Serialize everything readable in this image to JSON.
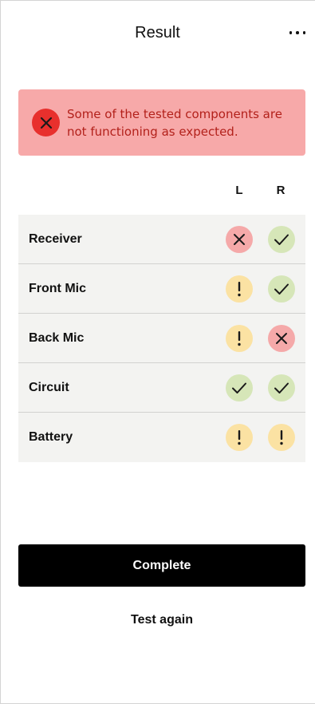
{
  "header": {
    "title": "Result",
    "more_icon": "more-horizontal-icon"
  },
  "alert": {
    "icon": "error-x-icon",
    "message": "Some of the tested components are not functioning as expected.",
    "colors": {
      "background": "#f7a9a9",
      "text": "#b3211b",
      "icon_bg": "#e8302d"
    }
  },
  "columns": {
    "left": "L",
    "right": "R"
  },
  "status_colors": {
    "fail": "#f5a9a9",
    "pass": "#d6e6b8",
    "warn": "#fbe2a3"
  },
  "components": [
    {
      "label": "Receiver",
      "left": "fail",
      "right": "pass"
    },
    {
      "label": "Front Mic",
      "left": "warn",
      "right": "pass"
    },
    {
      "label": "Back Mic",
      "left": "warn",
      "right": "fail"
    },
    {
      "label": "Circuit",
      "left": "pass",
      "right": "pass"
    },
    {
      "label": "Battery",
      "left": "warn",
      "right": "warn"
    }
  ],
  "actions": {
    "complete_label": "Complete",
    "test_again_label": "Test again"
  }
}
